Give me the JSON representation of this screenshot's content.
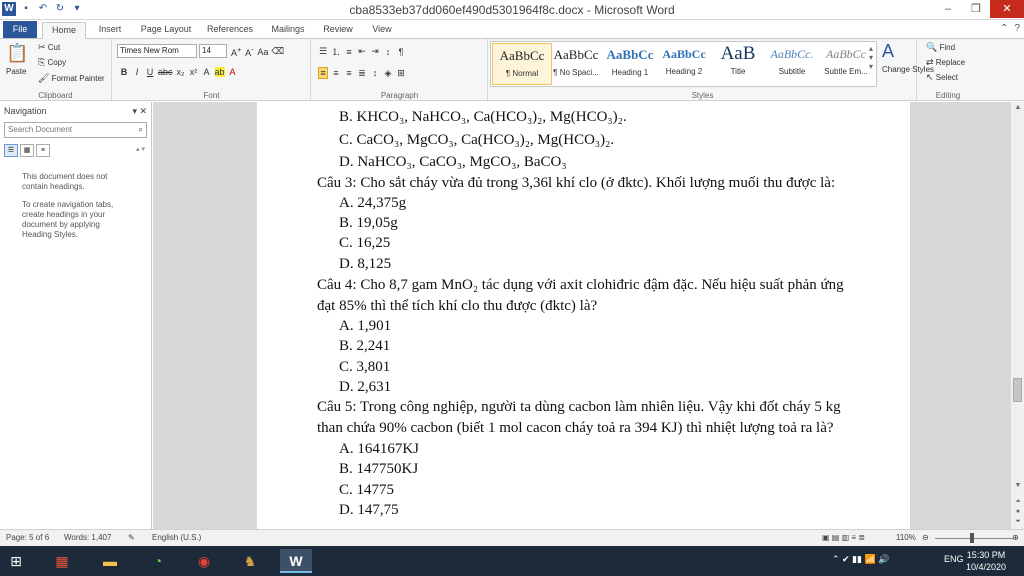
{
  "window": {
    "title": "cba8533eb37dd060ef490d5301964f8c.docx - Microsoft Word",
    "controls": {
      "minimize": "–",
      "restore": "❐",
      "close": "✕"
    }
  },
  "tabs": [
    "File",
    "Home",
    "Insert",
    "Page Layout",
    "References",
    "Mailings",
    "Review",
    "View"
  ],
  "ribbon": {
    "clipboard": {
      "paste": "Paste",
      "cut": "Cut",
      "copy": "Copy",
      "format_painter": "Format Painter",
      "label": "Clipboard"
    },
    "font": {
      "name": "Times New Rom",
      "size": "14",
      "label": "Font"
    },
    "paragraph": {
      "label": "Paragraph"
    },
    "styles": {
      "label": "Styles",
      "items": [
        {
          "preview": "AaBbCc",
          "name": "¶ Normal"
        },
        {
          "preview": "AaBbCc",
          "name": "¶ No Spaci..."
        },
        {
          "preview": "AaBbCc",
          "name": "Heading 1"
        },
        {
          "preview": "AaBbCc",
          "name": "Heading 2"
        },
        {
          "preview": "AaB",
          "name": "Title"
        },
        {
          "preview": "AaBbCc.",
          "name": "Subtitle"
        },
        {
          "preview": "AaBbCc",
          "name": "Subtle Em..."
        }
      ],
      "change_styles": "Change Styles"
    },
    "editing": {
      "find": "Find",
      "replace": "Replace",
      "select": "Select",
      "label": "Editing"
    }
  },
  "nav": {
    "title": "Navigation",
    "search_placeholder": "Search Document",
    "msg1": "This document does not contain headings.",
    "msg2": "To create navigation tabs, create headings in your document by applying Heading Styles."
  },
  "document": {
    "lines": [
      "B.  KHCO₃, NaHCO₃, Ca(HCO₃)₂, Mg(HCO₃)₂.",
      "C.  CaCO₃, MgCO₃,  Ca(HCO₃)₂, Mg(HCO₃)₂.",
      "D.  NaHCO₃, CaCO₃, MgCO₃, BaCO₃",
      "Câu 3: Cho sắt cháy vừa đủ trong 3,36l khí clo (ở đktc). Khối lượng muối thu được là:",
      "A. 24,375g",
      "B. 19,05g",
      "C. 16,25",
      "D. 8,125",
      "Câu 4: Cho 8,7 gam MnO₂ tác dụng với axit clohiđric đậm đặc. Nếu hiệu suất phản ứng",
      "đạt 85% thì thể tích khí clo thu được (đktc) là?",
      "A. 1,901",
      "B. 2,241",
      "C. 3,801",
      "D. 2,631",
      "Câu 5: Trong công nghiệp, người ta dùng cacbon làm nhiên liệu. Vậy khi đốt cháy 5 kg",
      "than chứa 90% cacbon (biết 1 mol cacon cháy toả ra 394 KJ) thì nhiệt lượng toả ra là?",
      "A. 164167KJ",
      "B. 147750KJ",
      "C. 14775",
      "D. 147,75"
    ]
  },
  "status": {
    "page": "Page: 5 of 6",
    "words": "Words: 1,407",
    "language": "English (U.S.)",
    "zoom": "110%"
  },
  "taskbar": {
    "tray_lang": "ENG",
    "time": "15:30 PM",
    "date": "10/4/2020"
  },
  "colors": {
    "accent": "#2b579a",
    "close": "#c42b1c",
    "taskbar": "#1c2a3a"
  }
}
